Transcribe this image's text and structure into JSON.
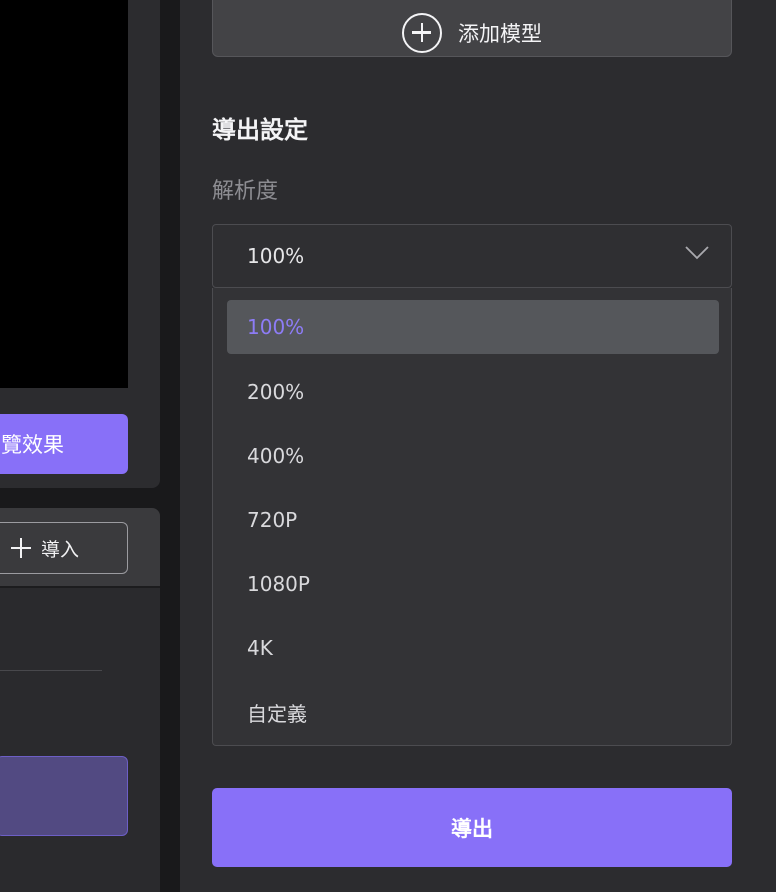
{
  "left": {
    "preview_button_label": "覽效果",
    "import_button_label": "導入"
  },
  "right": {
    "add_model_label": "添加模型",
    "section_title": "導出設定",
    "resolution_label": "解析度",
    "resolution_value": "100%",
    "options": [
      "100%",
      "200%",
      "400%",
      "720P",
      "1080P",
      "4K",
      "自定義"
    ],
    "selected_option": "100%",
    "export_label": "導出"
  },
  "colors": {
    "accent": "#8870f8",
    "selected_text": "#8d7cf6",
    "panel": "#2c2c2f",
    "background": "#19191b"
  }
}
